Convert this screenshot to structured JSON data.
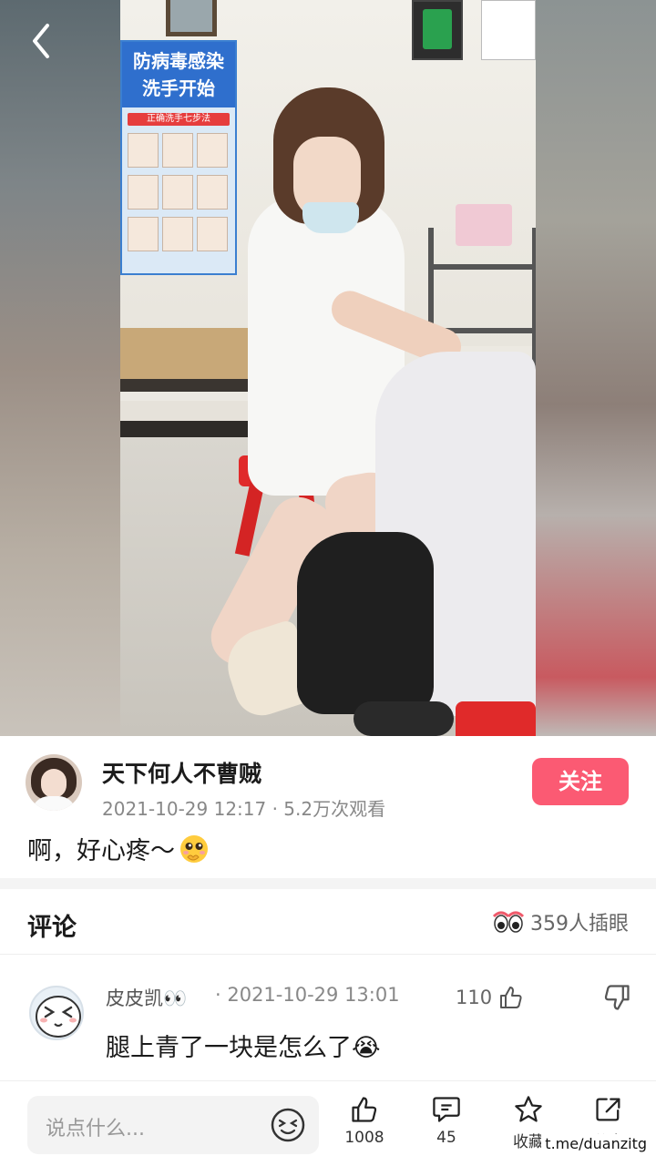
{
  "author": {
    "name": "天下何人不曹贼",
    "meta": "2021-10-29 12:17 · 5.2万次观看",
    "follow_label": "关注"
  },
  "post": {
    "caption": "啊，好心疼～"
  },
  "poster": {
    "title_line1": "防病毒感染",
    "title_line2": "洗手开始",
    "subtitle": "正确洗手七步法"
  },
  "comments": {
    "title": "评论",
    "eyes_count": "359人插眼",
    "items": [
      {
        "name": "皮皮凯👀",
        "time": "· 2021-10-29 13:01",
        "likes": "110",
        "text": "腿上青了一块是怎么了😭"
      }
    ]
  },
  "bottom_bar": {
    "input_placeholder": "说点什么...",
    "like_count": "1008",
    "comment_count": "45",
    "favorite_label": "收藏",
    "share_label": "分享"
  },
  "watermark": "t.me/duanzitg",
  "colors": {
    "accent": "#fb5a73",
    "text_primary": "#1b1b1b",
    "text_secondary": "#888888"
  },
  "icons": {
    "back": "chevron-left-icon",
    "like": "thumbs-up-icon",
    "dislike": "thumbs-down-icon",
    "comment": "speech-bubble-icon",
    "favorite": "star-icon",
    "share": "share-arrow-icon",
    "emoji": "emoji-face-icon"
  }
}
